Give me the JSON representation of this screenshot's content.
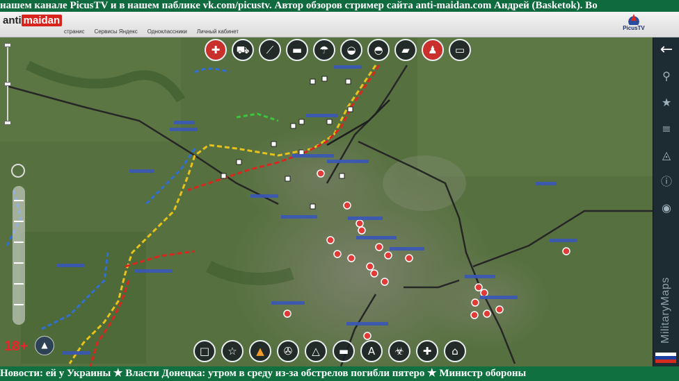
{
  "ticker_top": "нашем канале PicusTV и в нашем паблике vk.com/picustv. Автор обзоров стример сайта anti-maidan.com Андрей (Basketok). Во",
  "ticker_bottom": "Новости: ей у Украины ★ Власти Донецка: утром в среду из-за обстрелов погибли пятеро ★ Министр обороны",
  "brand": {
    "part1": "anti",
    "part2": "maidan"
  },
  "bookmarks": [
    "странис",
    "Сервисы Яндекс",
    "Одноклассники",
    "Личный кабинет"
  ],
  "channel": {
    "name": "PicusTV"
  },
  "age_rating": "18+",
  "side_text": "MilitaryMaps",
  "top_icons": [
    "medical-icon",
    "car-icon",
    "artillery-icon",
    "apc-icon",
    "paratrooper-icon",
    "tank-icon",
    "tank-icon",
    "self-propelled-gun-icon",
    "soldier-icon",
    "armored-vehicle-icon"
  ],
  "bottom_icons": [
    "square-icon",
    "star-icon",
    "fire-icon",
    "wrench-icon",
    "triangle-icon",
    "minus-icon",
    "letter-a-icon",
    "biohazard-icon",
    "medical-cross-icon",
    "bunker-icon"
  ],
  "bottom_a_label": "A",
  "right_icons": [
    "back-arrow-icon",
    "location-pin-icon",
    "star-icon",
    "menu-icon",
    "triangle-icon",
    "info-icon",
    "globe-icon"
  ],
  "colors": {
    "ticker_green": "#10703f",
    "front_red": "#d9261f",
    "front_yellow": "#e7c21a",
    "blue_line": "#2f6fd6",
    "road": "#2a2a2a",
    "panel": "#1d2b32"
  }
}
